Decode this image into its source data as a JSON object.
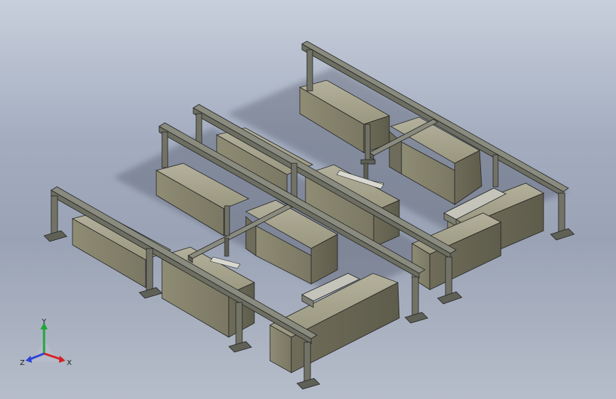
{
  "viewport": {
    "background_top": "#c8cfdc",
    "background_bottom": "#9aa3b5"
  },
  "model": {
    "body_color": "#85826f",
    "frame_color": "#74756a",
    "edge_color": "#222222"
  },
  "triad": {
    "x_label": "X",
    "y_label": "Y",
    "z_label": "Z",
    "x_color": "#d42020",
    "y_color": "#1fa63a",
    "z_color": "#2b44d8"
  }
}
